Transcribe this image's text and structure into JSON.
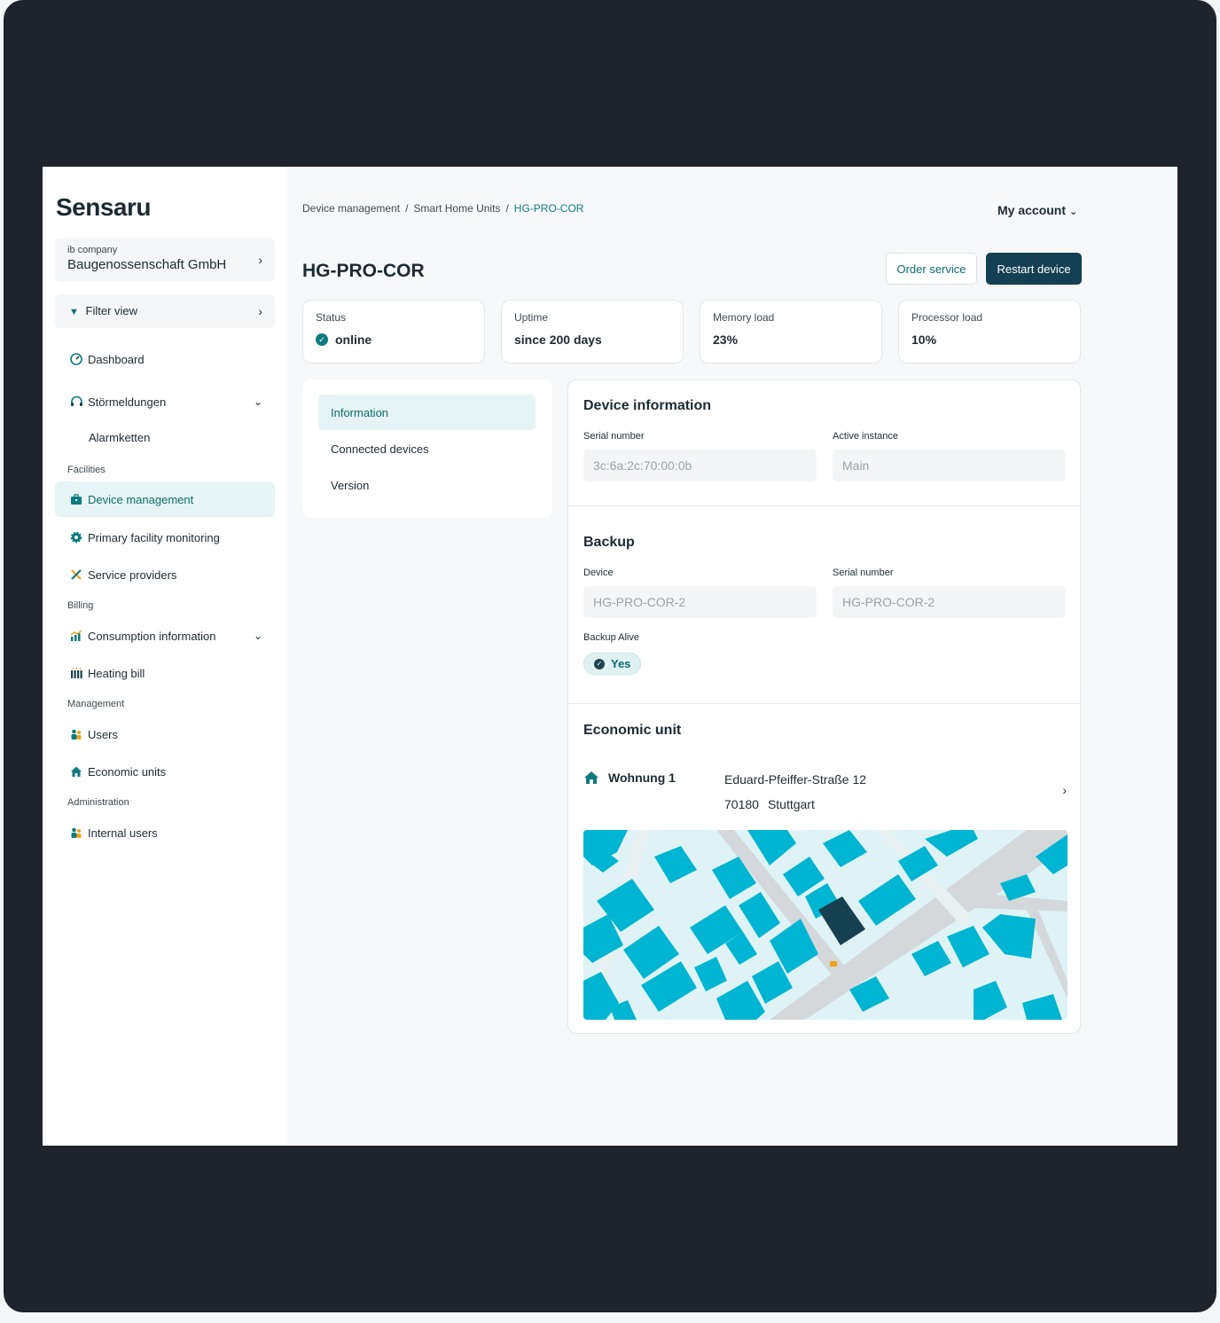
{
  "sidebar": {
    "logo": "Sensaru",
    "company_label": "ib company",
    "company_name": "Baugenossenschaft GmbH",
    "filter_label": "Filter view",
    "items": {
      "dashboard": "Dashboard",
      "stoermeldungen": "Störmeldungen",
      "alarmketten": "Alarmketten",
      "device_management": "Device management",
      "primary_facility": "Primary facility monitoring",
      "service_providers": "Service providers",
      "consumption": "Consumption information",
      "heating_bill": "Heating bill",
      "users": "Users",
      "economic_units": "Economic units",
      "internal_users": "Internal users"
    },
    "sections": {
      "facilities": "Facilities",
      "billing": "Billing",
      "management": "Management",
      "administration": "Administration"
    }
  },
  "header": {
    "breadcrumb": [
      "Device management",
      "Smart Home Units",
      "HG-PRO-COR"
    ],
    "separator": "/",
    "account": "My account",
    "title": "HG-PRO-COR",
    "order_service": "Order service",
    "restart_device": "Restart device"
  },
  "stats": [
    {
      "label": "Status",
      "value": "online"
    },
    {
      "label": "Uptime",
      "value": "since 200 days"
    },
    {
      "label": "Memory load",
      "value": "23%"
    },
    {
      "label": "Processor load",
      "value": "10%"
    }
  ],
  "tabs": [
    "Information",
    "Connected devices",
    "Version"
  ],
  "device_info": {
    "title": "Device information",
    "serial_label": "Serial number",
    "serial_value": "3c:6a:2c:70:00:0b",
    "instance_label": "Active instance",
    "instance_value": "Main"
  },
  "backup": {
    "title": "Backup",
    "device_label": "Device",
    "device_value": "HG-PRO-COR-2",
    "serial_label": "Serial number",
    "serial_value": "HG-PRO-COR-2",
    "alive_label": "Backup Alive",
    "alive_value": "Yes"
  },
  "economic_unit": {
    "title": "Economic unit",
    "name": "Wohnung 1",
    "street": "Eduard-Pfeiffer-Straße 12",
    "zip": "70180",
    "city": "Stuttgart"
  },
  "colors": {
    "accent": "#0f7a80",
    "dark_button": "#153f52",
    "map_building": "#00b5d1",
    "map_water": "#dff3f7",
    "map_road": "#d4d8da",
    "map_target": "#163f50"
  },
  "icons": {
    "dashboard": "gauge-icon",
    "stoermeldungen": "headset-icon",
    "device_management": "toolbox-icon",
    "primary_facility": "gear-icon",
    "service_providers": "tools-icon",
    "consumption": "chart-icon",
    "heating_bill": "radiator-icon",
    "users": "users-icon",
    "economic_units": "house-icon",
    "internal_users": "users-icon"
  }
}
